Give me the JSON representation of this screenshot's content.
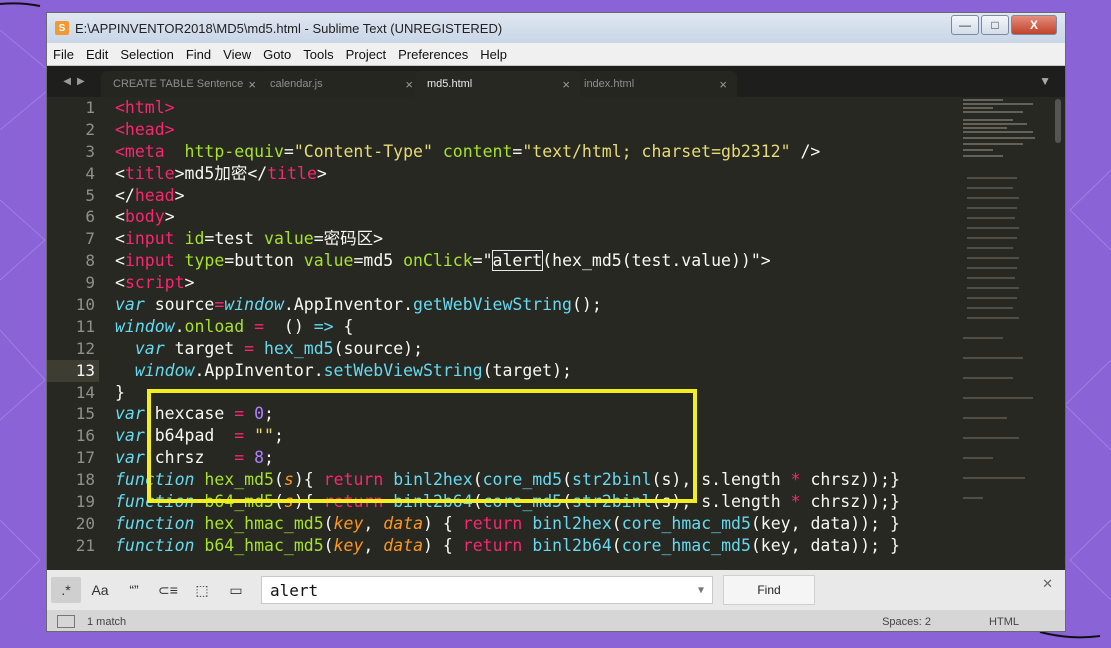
{
  "window": {
    "title": "E:\\APPINVENTOR2018\\MD5\\md5.html - Sublime Text (UNREGISTERED)",
    "buttons": {
      "minimize": "—",
      "maximize": "□",
      "close": "X"
    }
  },
  "menu": [
    "File",
    "Edit",
    "Selection",
    "Find",
    "View",
    "Goto",
    "Tools",
    "Project",
    "Preferences",
    "Help"
  ],
  "tabs": [
    {
      "label": "CREATE TABLE Sentence",
      "close": "×"
    },
    {
      "label": "calendar.js",
      "close": "×"
    },
    {
      "label": "md5.html",
      "close": "×",
      "active": true
    },
    {
      "label": "index.html",
      "close": "×"
    }
  ],
  "tab_nav": {
    "left": "◀",
    "right": "▶",
    "menu": "▼"
  },
  "editor": {
    "line_numbers": [
      "1",
      "2",
      "3",
      "4",
      "5",
      "6",
      "7",
      "8",
      "9",
      "10",
      "11",
      "12",
      "13",
      "14",
      "15",
      "16",
      "17",
      "18",
      "19",
      "20",
      "21"
    ],
    "current_line": 13,
    "lines": [
      [
        [
          "t",
          "<html>"
        ]
      ],
      [
        [
          "t",
          "<head>"
        ]
      ],
      [
        [
          "t",
          "<meta"
        ],
        [
          "",
          "  "
        ],
        [
          "a",
          "http-equiv"
        ],
        [
          "",
          "="
        ],
        [
          "s",
          "\"Content-Type\""
        ],
        [
          "",
          " "
        ],
        [
          "a",
          "content"
        ],
        [
          "",
          "="
        ],
        [
          "s",
          "\"text/html; charset=gb2312\""
        ],
        [
          "",
          " />"
        ]
      ],
      [
        [
          "",
          "<"
        ],
        [
          "t",
          "title"
        ],
        [
          "",
          ">md5加密</"
        ],
        [
          "t",
          "title"
        ],
        [
          "",
          ">"
        ]
      ],
      [
        [
          "",
          "</"
        ],
        [
          "t",
          "head"
        ],
        [
          "",
          ">"
        ]
      ],
      [
        [
          "",
          "<"
        ],
        [
          "t",
          "body"
        ],
        [
          "",
          ">"
        ]
      ],
      [
        [
          "",
          "<"
        ],
        [
          "t",
          "input"
        ],
        [
          "",
          " "
        ],
        [
          "a",
          "id"
        ],
        [
          "",
          "=test "
        ],
        [
          "a",
          "value"
        ],
        [
          "",
          "=密码区>"
        ]
      ],
      [
        [
          "",
          "<"
        ],
        [
          "t",
          "input"
        ],
        [
          "",
          " "
        ],
        [
          "a",
          "type"
        ],
        [
          "",
          "=button "
        ],
        [
          "a",
          "value"
        ],
        [
          "",
          "=md5 "
        ],
        [
          "a",
          "onClick"
        ],
        [
          "",
          "=\""
        ],
        [
          "hl",
          "alert"
        ],
        [
          "",
          "(hex_md5(test.value))\">"
        ]
      ],
      [
        [
          "",
          "<"
        ],
        [
          "t",
          "script"
        ],
        [
          "",
          ">"
        ]
      ],
      [
        [
          "k",
          "var"
        ],
        [
          "",
          " source"
        ],
        [
          "t",
          "="
        ],
        [
          "k",
          "window"
        ],
        [
          "",
          ".AppInventor."
        ],
        [
          "c",
          "getWebViewString"
        ],
        [
          "",
          "();"
        ]
      ],
      [
        [
          "k",
          "window"
        ],
        [
          "",
          "."
        ],
        [
          "f",
          "onload"
        ],
        [
          "",
          " "
        ],
        [
          "t",
          "="
        ],
        [
          "",
          "  () "
        ],
        [
          "c",
          "=>"
        ],
        [
          "",
          " {"
        ]
      ],
      [
        [
          "",
          "  "
        ],
        [
          "k",
          "var"
        ],
        [
          "",
          " target "
        ],
        [
          "t",
          "="
        ],
        [
          "",
          " "
        ],
        [
          "c",
          "hex_md5"
        ],
        [
          "",
          "(source);"
        ]
      ],
      [
        [
          "",
          "  "
        ],
        [
          "k",
          "window"
        ],
        [
          "",
          ".AppInventor."
        ],
        [
          "c",
          "setWebViewString"
        ],
        [
          "",
          "(target);"
        ]
      ],
      [
        [
          "",
          "}"
        ]
      ],
      [
        [
          "k",
          "var"
        ],
        [
          "",
          " hexcase "
        ],
        [
          "t",
          "="
        ],
        [
          "",
          " "
        ],
        [
          "n",
          "0"
        ],
        [
          "",
          ";"
        ]
      ],
      [
        [
          "k",
          "var"
        ],
        [
          "",
          " b64pad  "
        ],
        [
          "t",
          "="
        ],
        [
          "",
          " "
        ],
        [
          "s",
          "\"\""
        ],
        [
          "",
          ";"
        ]
      ],
      [
        [
          "k",
          "var"
        ],
        [
          "",
          " chrsz   "
        ],
        [
          "t",
          "="
        ],
        [
          "",
          " "
        ],
        [
          "n",
          "8"
        ],
        [
          "",
          ";"
        ]
      ],
      [
        [
          "k",
          "function"
        ],
        [
          "",
          " "
        ],
        [
          "f",
          "hex_md5"
        ],
        [
          "",
          "("
        ],
        [
          "p",
          "s"
        ],
        [
          "",
          "){ "
        ],
        [
          "t",
          "return"
        ],
        [
          "",
          " "
        ],
        [
          "c",
          "binl2hex"
        ],
        [
          "",
          "("
        ],
        [
          "c",
          "core_md5"
        ],
        [
          "",
          "("
        ],
        [
          "c",
          "str2binl"
        ],
        [
          "",
          "(s), s.length "
        ],
        [
          "t",
          "*"
        ],
        [
          "",
          " chrsz));}"
        ]
      ],
      [
        [
          "k",
          "function"
        ],
        [
          "",
          " "
        ],
        [
          "f",
          "b64_md5"
        ],
        [
          "",
          "("
        ],
        [
          "p",
          "s"
        ],
        [
          "",
          "){ "
        ],
        [
          "t",
          "return"
        ],
        [
          "",
          " "
        ],
        [
          "c",
          "binl2b64"
        ],
        [
          "",
          "("
        ],
        [
          "c",
          "core_md5"
        ],
        [
          "",
          "("
        ],
        [
          "c",
          "str2binl"
        ],
        [
          "",
          "(s), s.length "
        ],
        [
          "t",
          "*"
        ],
        [
          "",
          " chrsz));}"
        ]
      ],
      [
        [
          "k",
          "function"
        ],
        [
          "",
          " "
        ],
        [
          "f",
          "hex_hmac_md5"
        ],
        [
          "",
          "("
        ],
        [
          "p",
          "key"
        ],
        [
          ", ",
          ", "
        ],
        [
          "p",
          "data"
        ],
        [
          "",
          ") { "
        ],
        [
          "t",
          "return"
        ],
        [
          "",
          " "
        ],
        [
          "c",
          "binl2hex"
        ],
        [
          "",
          "("
        ],
        [
          "c",
          "core_hmac_md5"
        ],
        [
          "",
          "(key, data)); }"
        ]
      ],
      [
        [
          "k",
          "function"
        ],
        [
          "",
          " "
        ],
        [
          "f",
          "b64_hmac_md5"
        ],
        [
          "",
          "("
        ],
        [
          "p",
          "key"
        ],
        [
          ", ",
          ", "
        ],
        [
          "p",
          "data"
        ],
        [
          "",
          ") { "
        ],
        [
          "t",
          "return"
        ],
        [
          "",
          " "
        ],
        [
          "c",
          "binl2b64"
        ],
        [
          "",
          "("
        ],
        [
          "c",
          "core_hmac_md5"
        ],
        [
          "",
          "(key, data)); }"
        ]
      ]
    ]
  },
  "find": {
    "buttons": [
      ".*",
      "Aa",
      "“”",
      "⊂≡",
      "⬚",
      "▭"
    ],
    "query": "alert",
    "find_label": "Find"
  },
  "status": {
    "matches": "1 match",
    "spaces": "Spaces: 2",
    "syntax": "HTML"
  },
  "colors": {
    "highlight_box": "#f5ee1e",
    "background": "#8a63d6",
    "editor": "#272822"
  }
}
